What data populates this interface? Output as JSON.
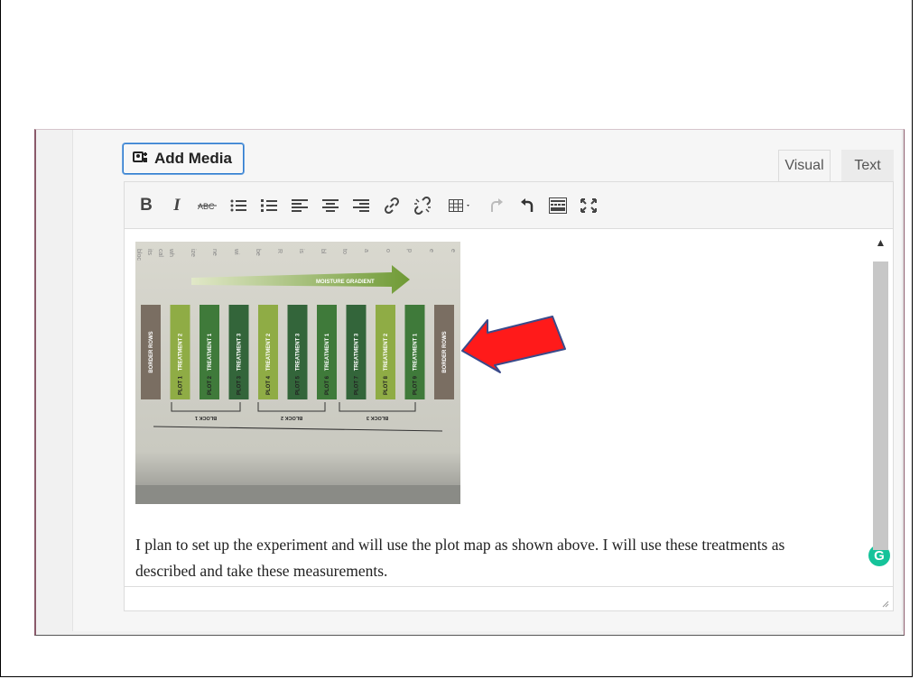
{
  "editor": {
    "add_media_label": "Add Media",
    "tabs": [
      {
        "label": "Visual",
        "active": true
      },
      {
        "label": "Text",
        "active": false
      }
    ],
    "toolbar": [
      "bold",
      "italic",
      "strikethrough",
      "bulleted-list",
      "numbered-list",
      "align-left",
      "align-center",
      "align-right",
      "insert-link",
      "remove-link",
      "table",
      "redo",
      "undo",
      "toolbar-toggle",
      "fullscreen"
    ],
    "body_text": "I plan to set up the experiment and will use the plot map as shown above.  I will use these treatments as described and take these measurements."
  },
  "photo": {
    "gradient_label": "MOISTURE GRADIENT",
    "columns": [
      "BORDER ROWS",
      "TREATMENT 2",
      "TREATMENT 1",
      "TREATMENT 3",
      "TREATMENT 2",
      "TREATMENT 3",
      "TREATMENT 1",
      "TREATMENT 3",
      "TREATMENT 2",
      "TREATMENT 1",
      "BORDER ROWS"
    ],
    "plots": [
      "PLOT 1",
      "PLOT 2",
      "PLOT 3",
      "PLOT 4",
      "PLOT 5",
      "PLOT 6",
      "PLOT 7",
      "PLOT 8",
      "PLOT 9"
    ],
    "blocks": [
      "BLOCK 1",
      "BLOCK 2",
      "BLOCK 3"
    ]
  },
  "colors": {
    "annotation_arrow": "#ff1a1a",
    "arrow_outline": "#3a4a8a",
    "focus_blue": "#2e7bcf",
    "grammarly": "#15c39a"
  }
}
